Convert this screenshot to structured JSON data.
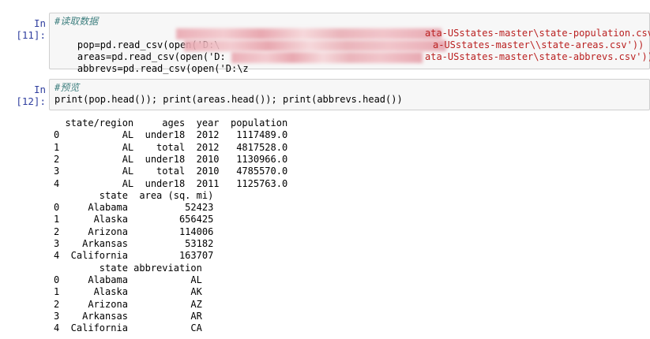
{
  "cells": [
    {
      "prompt": "In [11]:",
      "comment": "#读取数据",
      "lines": [
        {
          "prefix": "pop=pd.read_csv(open('D:\\",
          "suffix": "ata-USstates-master\\state-population.csv'))"
        },
        {
          "prefix": "areas=pd.read_csv(open('D:",
          "suffix": "a-USstates-master\\\\state-areas.csv'))"
        },
        {
          "prefix": "abbrevs=pd.read_csv(open('D:\\z",
          "suffix": "ata-USstates-master\\state-abbrevs.csv'))"
        }
      ]
    },
    {
      "prompt": "In [12]:",
      "comment": "#预览",
      "code": "print(pop.head()); print(areas.head()); print(abbrevs.head())"
    }
  ],
  "output": [
    "  state/region     ages  year  population",
    "0           AL  under18  2012   1117489.0",
    "1           AL    total  2012   4817528.0",
    "2           AL  under18  2010   1130966.0",
    "3           AL    total  2010   4785570.0",
    "4           AL  under18  2011   1125763.0",
    "        state  area (sq. mi)",
    "0     Alabama          52423",
    "1      Alaska         656425",
    "2     Arizona         114006",
    "3    Arkansas          53182",
    "4  California         163707",
    "        state abbreviation",
    "0     Alabama           AL",
    "1      Alaska           AK",
    "2     Arizona           AZ",
    "3    Arkansas           AR",
    "4  California           CA"
  ]
}
